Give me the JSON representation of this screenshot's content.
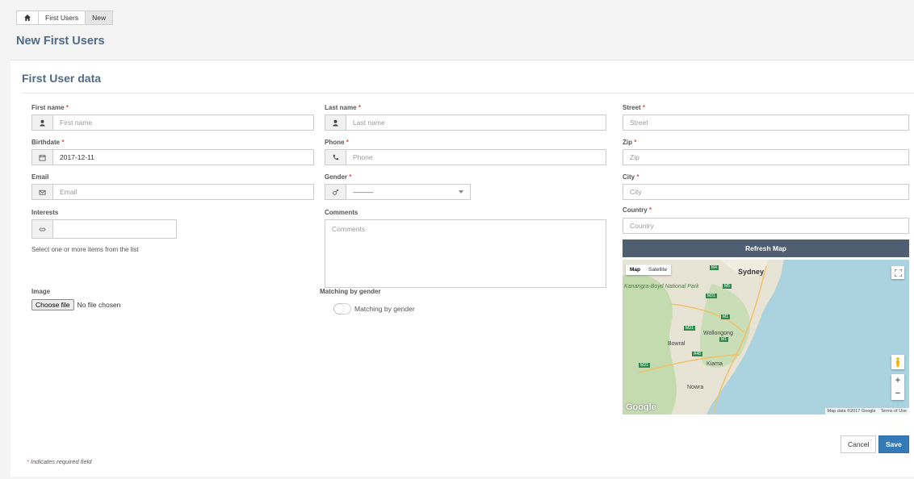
{
  "breadcrumb": {
    "items": [
      "First Users",
      "New"
    ]
  },
  "page_title": "New First Users",
  "panel_title": "First User data",
  "fields": {
    "first_name": {
      "label": "First name",
      "required_mark": "*",
      "placeholder": "First name",
      "icon": "user-icon"
    },
    "last_name": {
      "label": "Last name",
      "required_mark": "*",
      "placeholder": "Last name",
      "icon": "user-icon"
    },
    "street": {
      "label": "Street",
      "required_mark": "*",
      "placeholder": "Street"
    },
    "birthdate": {
      "label": "Birthdate",
      "required_mark": "*",
      "value": "2017-12-11",
      "icon": "calendar-icon"
    },
    "phone": {
      "label": "Phone",
      "required_mark": "*",
      "placeholder": "Phone",
      "icon": "phone-icon"
    },
    "zip": {
      "label": "Zip",
      "required_mark": "*",
      "placeholder": "Zip"
    },
    "email": {
      "label": "Email",
      "placeholder": "Email",
      "icon": "envelope-icon"
    },
    "gender": {
      "label": "Gender",
      "required_mark": "*",
      "value": "———",
      "icon": "gender-icon"
    },
    "city": {
      "label": "City",
      "required_mark": "*",
      "placeholder": "City"
    },
    "interests": {
      "label": "Interests",
      "help": "Select one or more items from the list",
      "icon": "handshake-icon"
    },
    "comments": {
      "label": "Comments",
      "placeholder": "Comments"
    },
    "country": {
      "label": "Country",
      "required_mark": "*",
      "placeholder": "Country"
    },
    "image": {
      "label": "Image",
      "button": "Choose file",
      "status": "No file chosen"
    },
    "matching": {
      "label": "Matching by gender",
      "toggle_label": "Matching by gender",
      "value": false
    }
  },
  "map": {
    "refresh_label": "Refresh Map",
    "types": [
      "Map",
      "Satellite"
    ],
    "selected_type": "Map",
    "places": {
      "sydney": "Sydney",
      "park": "Kanangra-Boyd National Park",
      "wollongong": "Wollongong",
      "bowral": "Bowral",
      "kiama": "Kiama",
      "nowra": "Nowra"
    },
    "roads": [
      "M4",
      "M5",
      "M31",
      "M1",
      "A48"
    ],
    "logo": "Google",
    "attribution": "Map data ©2017 Google",
    "terms": "Terms of Use",
    "zoom_in": "+",
    "zoom_out": "−"
  },
  "actions": {
    "cancel": "Cancel",
    "save": "Save"
  },
  "required_note": "Indicates required field",
  "required_note_mark": "*",
  "colors": {
    "title": "#506a85",
    "primary": "#337ab7",
    "refresh": "#4f5f71",
    "required": "#d9534f"
  }
}
